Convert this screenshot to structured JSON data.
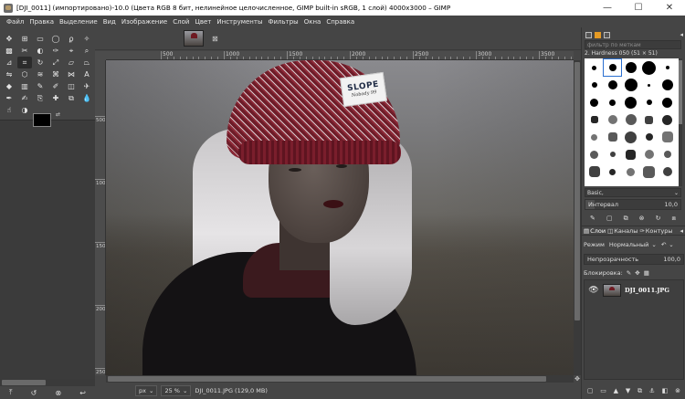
{
  "window": {
    "title": "[DJI_0011] (импортировано)-10.0 (Цвета RGB 8 бит, нелинейное целочисленное, GIMP built-in sRGB, 1 слой) 4000x3000 – GIMP",
    "controls": {
      "minimize": "—",
      "maximize": "☐",
      "close": "✕"
    }
  },
  "menu": [
    "Файл",
    "Правка",
    "Выделение",
    "Вид",
    "Изображение",
    "Слой",
    "Цвет",
    "Инструменты",
    "Фильтры",
    "Окна",
    "Справка"
  ],
  "toolbox": {
    "tools": [
      {
        "icon": "move-tool-icon",
        "glyph": "✥"
      },
      {
        "icon": "align-tool-icon",
        "glyph": "⊞"
      },
      {
        "icon": "rect-select-icon",
        "glyph": "▭"
      },
      {
        "icon": "ellipse-select-icon",
        "glyph": "◯"
      },
      {
        "icon": "free-select-icon",
        "glyph": "ϼ"
      },
      {
        "icon": "fuzzy-select-icon",
        "glyph": "✧"
      },
      {
        "icon": "color-select-icon",
        "glyph": "▩"
      },
      {
        "icon": "scissors-select-icon",
        "glyph": "✂"
      },
      {
        "icon": "foreground-select-icon",
        "glyph": "◐"
      },
      {
        "icon": "paths-tool-icon",
        "glyph": "✑"
      },
      {
        "icon": "color-picker-icon",
        "glyph": "⌖"
      },
      {
        "icon": "zoom-tool-icon",
        "glyph": "⌕"
      },
      {
        "icon": "measure-tool-icon",
        "glyph": "⊿"
      },
      {
        "icon": "crop-tool-icon",
        "glyph": "⌗"
      },
      {
        "icon": "rotate-tool-icon",
        "glyph": "↻"
      },
      {
        "icon": "scale-tool-icon",
        "glyph": "⤢"
      },
      {
        "icon": "shear-tool-icon",
        "glyph": "▱"
      },
      {
        "icon": "perspective-tool-icon",
        "glyph": "⏢"
      },
      {
        "icon": "flip-tool-icon",
        "glyph": "⇋"
      },
      {
        "icon": "cage-tool-icon",
        "glyph": "⬡"
      },
      {
        "icon": "warp-tool-icon",
        "glyph": "≋"
      },
      {
        "icon": "unified-transform-icon",
        "glyph": "⌘"
      },
      {
        "icon": "handle-transform-icon",
        "glyph": "⋈"
      },
      {
        "icon": "text-tool-icon",
        "glyph": "A"
      },
      {
        "icon": "bucket-fill-icon",
        "glyph": "◆"
      },
      {
        "icon": "gradient-tool-icon",
        "glyph": "▥"
      },
      {
        "icon": "pencil-tool-icon",
        "glyph": "✎"
      },
      {
        "icon": "paintbrush-tool-icon",
        "glyph": "✐"
      },
      {
        "icon": "eraser-tool-icon",
        "glyph": "◫"
      },
      {
        "icon": "airbrush-tool-icon",
        "glyph": "✈"
      },
      {
        "icon": "ink-tool-icon",
        "glyph": "✒"
      },
      {
        "icon": "mypaint-brush-icon",
        "glyph": "✍"
      },
      {
        "icon": "clone-tool-icon",
        "glyph": "⎘"
      },
      {
        "icon": "heal-tool-icon",
        "glyph": "✚"
      },
      {
        "icon": "perspective-clone-icon",
        "glyph": "⧉"
      },
      {
        "icon": "blur-tool-icon",
        "glyph": "💧"
      },
      {
        "icon": "smudge-tool-icon",
        "glyph": "☝"
      },
      {
        "icon": "dodge-burn-icon",
        "glyph": "◑"
      }
    ],
    "selected_tool": 13,
    "foreground_color": "#000000",
    "background_color": "#ffffff",
    "tab_icons": [
      "tool-options-tab-icon",
      "device-status-tab-icon",
      "undo-history-tab-icon",
      "images-tab-icon"
    ],
    "tab_glyphs": [
      "⚙",
      "⎍",
      "↶",
      "▣"
    ],
    "bottom_buttons": [
      {
        "icon": "save-tool-preset-icon",
        "glyph": "⤒"
      },
      {
        "icon": "restore-tool-preset-icon",
        "glyph": "↺"
      },
      {
        "icon": "delete-tool-preset-icon",
        "glyph": "⊗"
      },
      {
        "icon": "reset-tool-options-icon",
        "glyph": "↩"
      }
    ]
  },
  "image_tab": {
    "close": "⊠"
  },
  "rulers": {
    "h_labels": [
      "500",
      "1000",
      "1500",
      "2000",
      "2500",
      "3000",
      "3500"
    ],
    "v_labels": [
      "0",
      "500",
      "1000",
      "1500",
      "2000",
      "2500"
    ]
  },
  "canvas": {
    "hat_brand": "SLOPE",
    "hat_sub": "Nobody 99"
  },
  "statusbar": {
    "unit": "px",
    "zoom": "25 %",
    "info": "DJI_0011.JPG (129,0 MB)",
    "dropdown": "⌄"
  },
  "dock": {
    "brush_filter_placeholder": "фильтр по меткам",
    "brush_name": "2. Hardness 050 (51 × 51)",
    "brush_preset": "Basic,",
    "spacing_label": "Интервал",
    "spacing_value": "10,0",
    "spacing_fraction": 0.1,
    "brush_buttons": [
      {
        "icon": "edit-brush-icon",
        "glyph": "✎"
      },
      {
        "icon": "new-brush-icon",
        "glyph": "▢"
      },
      {
        "icon": "duplicate-brush-icon",
        "glyph": "⧉"
      },
      {
        "icon": "delete-brush-icon",
        "glyph": "⊗"
      },
      {
        "icon": "refresh-brushes-icon",
        "glyph": "↻"
      },
      {
        "icon": "open-as-image-icon",
        "glyph": "⧈"
      }
    ],
    "tabs": [
      {
        "label": "Слои",
        "icon": "layers-tab-icon",
        "glyph": "▤"
      },
      {
        "label": "Каналы",
        "icon": "channels-tab-icon",
        "glyph": "◫"
      },
      {
        "label": "Контуры",
        "icon": "paths-tab-icon",
        "glyph": "✑"
      }
    ],
    "mode_label": "Режим",
    "mode_value": "Нормальный",
    "opacity_label": "Непрозрачность",
    "opacity_value": "100,0",
    "lock_label": "Блокировка:",
    "layer_name": "DJI_0011.JPG",
    "layer_buttons": [
      {
        "icon": "new-layer-icon",
        "glyph": "▢"
      },
      {
        "icon": "new-layer-group-icon",
        "glyph": "▭"
      },
      {
        "icon": "raise-layer-icon",
        "glyph": "▲"
      },
      {
        "icon": "lower-layer-icon",
        "glyph": "▼"
      },
      {
        "icon": "duplicate-layer-icon",
        "glyph": "⧉"
      },
      {
        "icon": "anchor-layer-icon",
        "glyph": "⚓"
      },
      {
        "icon": "layer-mask-icon",
        "glyph": "◧"
      },
      {
        "icon": "delete-layer-icon",
        "glyph": "⊗"
      }
    ]
  }
}
